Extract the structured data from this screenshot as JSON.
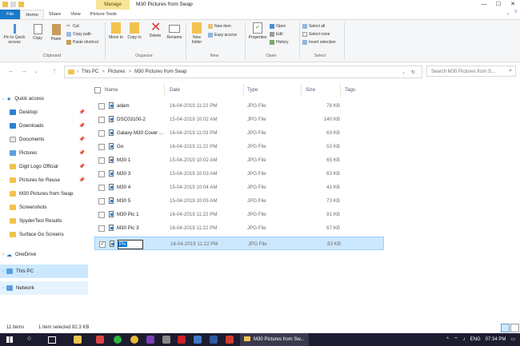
{
  "window": {
    "context_tab": "Manage",
    "title": "M30 Pictures from Swap",
    "controls": [
      "—",
      "☐",
      "✕"
    ]
  },
  "ribbon_tabs": [
    "File",
    "Home",
    "Share",
    "View",
    "Picture Tools"
  ],
  "ribbon_right": [
    "⌄",
    "?"
  ],
  "ribbon": {
    "clipboard": {
      "pin": "Pin to Quick access",
      "copy": "Copy",
      "paste": "Paste",
      "cut": "Cut",
      "copy_path": "Copy path",
      "paste_shortcut": "Paste shortcut",
      "label": "Clipboard"
    },
    "organise": {
      "move_to": "Move to",
      "copy_to": "Copy to",
      "delete": "Delete",
      "rename": "Rename",
      "label": "Organise"
    },
    "new": {
      "new_folder": "New folder",
      "new_item": "New item",
      "easy_access": "Easy access",
      "label": "New"
    },
    "open": {
      "properties": "Properties",
      "open": "Open",
      "edit": "Edit",
      "history": "History",
      "label": "Open"
    },
    "select": {
      "select_all": "Select all",
      "select_none": "Select none",
      "invert": "Invert selection",
      "label": "Select"
    }
  },
  "address": {
    "crumbs": [
      "This PC",
      ">",
      "Pictures",
      ">",
      "M30 Pictures from Swap"
    ],
    "search_placeholder": "Search M30 Pictures from S..."
  },
  "nav": [
    {
      "label": "Quick access",
      "pinned": false
    },
    {
      "label": "Desktop",
      "pinned": true
    },
    {
      "label": "Downloads",
      "pinned": true
    },
    {
      "label": "Documents",
      "pinned": true
    },
    {
      "label": "Pictures",
      "pinned": true
    },
    {
      "label": "Digit Logo Official",
      "pinned": true
    },
    {
      "label": "Pictures for Reuse",
      "pinned": true
    },
    {
      "label": "M30 Pictures from Swap",
      "pinned": false
    },
    {
      "label": "Screenshots",
      "pinned": false
    },
    {
      "label": "SpyderTest Results",
      "pinned": false
    },
    {
      "label": "Surface Go Screens",
      "pinned": false
    },
    {
      "label": "OneDrive",
      "pinned": false
    },
    {
      "label": "This PC",
      "pinned": false
    },
    {
      "label": "Network",
      "pinned": false
    }
  ],
  "columns": {
    "name": "Name",
    "date": "Date",
    "type": "Type",
    "size": "Size",
    "tags": "Tags"
  },
  "files": [
    {
      "name": "adam",
      "date": "16-04-2019 11:22 PM",
      "type": "JPG File",
      "size": "78 KB"
    },
    {
      "name": "DSC03100-2",
      "date": "15-04-2019 10:02 AM",
      "type": "JPG File",
      "size": "140 KB"
    },
    {
      "name": "Galaxy M30 Cover ...",
      "date": "16-04-2019 11:03 PM",
      "type": "JPG File",
      "size": "63 KB"
    },
    {
      "name": "Go",
      "date": "16-04-2019 11:22 PM",
      "type": "JPG File",
      "size": "53 KB"
    },
    {
      "name": "M30 1",
      "date": "15-04-2019 10:02 AM",
      "type": "JPG File",
      "size": "65 KB"
    },
    {
      "name": "M30 3",
      "date": "15-04-2019 10:03 AM",
      "type": "JPG File",
      "size": "63 KB"
    },
    {
      "name": "M30 4",
      "date": "15-04-2019 10:04 AM",
      "type": "JPG File",
      "size": "41 KB"
    },
    {
      "name": "M30 5",
      "date": "15-04-2019 10:05 AM",
      "type": "JPG File",
      "size": "73 KB"
    },
    {
      "name": "M30 Pic 1",
      "date": "16-04-2019 11:22 PM",
      "type": "JPG File",
      "size": "91 KB"
    },
    {
      "name": "M30 Pic 3",
      "date": "16-04-2019 11:22 PM",
      "type": "JPG File",
      "size": "67 KB"
    },
    {
      "name": "Pic",
      "date": "16-04-2019 11:22 PM",
      "type": "JPG File",
      "size": "83 KB"
    }
  ],
  "status": {
    "count": "11 items",
    "selected": "1 item selected 82.3 KB"
  },
  "taskbar": {
    "active_window": "M30 Pictures from Sw...",
    "time": "07:34 PM",
    "lang": "ENG"
  }
}
